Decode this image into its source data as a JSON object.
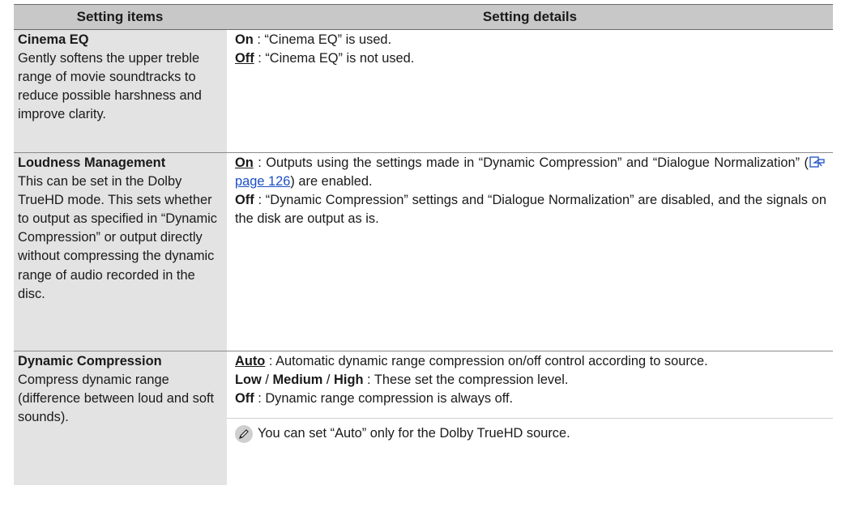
{
  "header": {
    "col1": "Setting items",
    "col2": "Setting details"
  },
  "rows": [
    {
      "name": "Cinema EQ",
      "desc": "Gently softens the upper treble range of movie soundtracks to reduce possible harshness and improve clarity.",
      "options": [
        {
          "key": "On",
          "underline": false,
          "text": " : “Cinema EQ” is used."
        },
        {
          "key": "Off",
          "underline": true,
          "text": " : “Cinema EQ” is not used."
        }
      ]
    },
    {
      "name": "Loudness Management",
      "desc": "This can be set in the Dolby TrueHD mode. This sets whether to output as specified in “Dynamic Compression” or output directly without compressing the dynamic range of audio recorded in the disc.",
      "options": [
        {
          "key": "On",
          "underline": true,
          "text_before": " : Outputs using the settings made in “Dynamic Compression” and “Dialogue Normalization” (",
          "link": "page 126",
          "text_after": ") are enabled."
        },
        {
          "key": "Off",
          "underline": false,
          "text": " : “Dynamic Compression” settings and “Dialogue Normalization” are disabled, and the signals on the disk are output as is."
        }
      ]
    },
    {
      "name": "Dynamic Compression",
      "desc": "Compress dynamic range (difference between loud and soft sounds).",
      "options": [
        {
          "key": "Auto",
          "underline": true,
          "text": " : Automatic dynamic range compression on/off control according to source."
        },
        {
          "key_parts": [
            "Low",
            " / ",
            "Medium",
            " / ",
            "High"
          ],
          "text": " : These set the compression level."
        },
        {
          "key": "Off",
          "underline": false,
          "text": " : Dynamic range compression is always off."
        }
      ],
      "note": "You can set “Auto” only for the Dolby TrueHD source."
    }
  ],
  "icons": {
    "reference": "page-reference-icon",
    "note": "pencil-icon"
  }
}
